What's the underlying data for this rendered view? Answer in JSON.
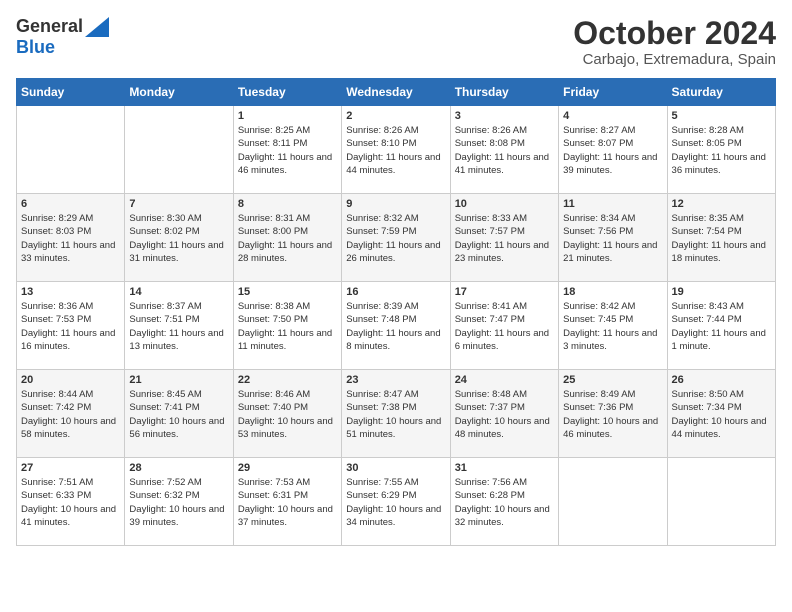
{
  "logo": {
    "general": "General",
    "blue": "Blue"
  },
  "header": {
    "month": "October 2024",
    "location": "Carbajo, Extremadura, Spain"
  },
  "weekdays": [
    "Sunday",
    "Monday",
    "Tuesday",
    "Wednesday",
    "Thursday",
    "Friday",
    "Saturday"
  ],
  "weeks": [
    [
      {
        "day": "",
        "sunrise": "",
        "sunset": "",
        "daylight": ""
      },
      {
        "day": "",
        "sunrise": "",
        "sunset": "",
        "daylight": ""
      },
      {
        "day": "1",
        "sunrise": "Sunrise: 8:25 AM",
        "sunset": "Sunset: 8:11 PM",
        "daylight": "Daylight: 11 hours and 46 minutes."
      },
      {
        "day": "2",
        "sunrise": "Sunrise: 8:26 AM",
        "sunset": "Sunset: 8:10 PM",
        "daylight": "Daylight: 11 hours and 44 minutes."
      },
      {
        "day": "3",
        "sunrise": "Sunrise: 8:26 AM",
        "sunset": "Sunset: 8:08 PM",
        "daylight": "Daylight: 11 hours and 41 minutes."
      },
      {
        "day": "4",
        "sunrise": "Sunrise: 8:27 AM",
        "sunset": "Sunset: 8:07 PM",
        "daylight": "Daylight: 11 hours and 39 minutes."
      },
      {
        "day": "5",
        "sunrise": "Sunrise: 8:28 AM",
        "sunset": "Sunset: 8:05 PM",
        "daylight": "Daylight: 11 hours and 36 minutes."
      }
    ],
    [
      {
        "day": "6",
        "sunrise": "Sunrise: 8:29 AM",
        "sunset": "Sunset: 8:03 PM",
        "daylight": "Daylight: 11 hours and 33 minutes."
      },
      {
        "day": "7",
        "sunrise": "Sunrise: 8:30 AM",
        "sunset": "Sunset: 8:02 PM",
        "daylight": "Daylight: 11 hours and 31 minutes."
      },
      {
        "day": "8",
        "sunrise": "Sunrise: 8:31 AM",
        "sunset": "Sunset: 8:00 PM",
        "daylight": "Daylight: 11 hours and 28 minutes."
      },
      {
        "day": "9",
        "sunrise": "Sunrise: 8:32 AM",
        "sunset": "Sunset: 7:59 PM",
        "daylight": "Daylight: 11 hours and 26 minutes."
      },
      {
        "day": "10",
        "sunrise": "Sunrise: 8:33 AM",
        "sunset": "Sunset: 7:57 PM",
        "daylight": "Daylight: 11 hours and 23 minutes."
      },
      {
        "day": "11",
        "sunrise": "Sunrise: 8:34 AM",
        "sunset": "Sunset: 7:56 PM",
        "daylight": "Daylight: 11 hours and 21 minutes."
      },
      {
        "day": "12",
        "sunrise": "Sunrise: 8:35 AM",
        "sunset": "Sunset: 7:54 PM",
        "daylight": "Daylight: 11 hours and 18 minutes."
      }
    ],
    [
      {
        "day": "13",
        "sunrise": "Sunrise: 8:36 AM",
        "sunset": "Sunset: 7:53 PM",
        "daylight": "Daylight: 11 hours and 16 minutes."
      },
      {
        "day": "14",
        "sunrise": "Sunrise: 8:37 AM",
        "sunset": "Sunset: 7:51 PM",
        "daylight": "Daylight: 11 hours and 13 minutes."
      },
      {
        "day": "15",
        "sunrise": "Sunrise: 8:38 AM",
        "sunset": "Sunset: 7:50 PM",
        "daylight": "Daylight: 11 hours and 11 minutes."
      },
      {
        "day": "16",
        "sunrise": "Sunrise: 8:39 AM",
        "sunset": "Sunset: 7:48 PM",
        "daylight": "Daylight: 11 hours and 8 minutes."
      },
      {
        "day": "17",
        "sunrise": "Sunrise: 8:41 AM",
        "sunset": "Sunset: 7:47 PM",
        "daylight": "Daylight: 11 hours and 6 minutes."
      },
      {
        "day": "18",
        "sunrise": "Sunrise: 8:42 AM",
        "sunset": "Sunset: 7:45 PM",
        "daylight": "Daylight: 11 hours and 3 minutes."
      },
      {
        "day": "19",
        "sunrise": "Sunrise: 8:43 AM",
        "sunset": "Sunset: 7:44 PM",
        "daylight": "Daylight: 11 hours and 1 minute."
      }
    ],
    [
      {
        "day": "20",
        "sunrise": "Sunrise: 8:44 AM",
        "sunset": "Sunset: 7:42 PM",
        "daylight": "Daylight: 10 hours and 58 minutes."
      },
      {
        "day": "21",
        "sunrise": "Sunrise: 8:45 AM",
        "sunset": "Sunset: 7:41 PM",
        "daylight": "Daylight: 10 hours and 56 minutes."
      },
      {
        "day": "22",
        "sunrise": "Sunrise: 8:46 AM",
        "sunset": "Sunset: 7:40 PM",
        "daylight": "Daylight: 10 hours and 53 minutes."
      },
      {
        "day": "23",
        "sunrise": "Sunrise: 8:47 AM",
        "sunset": "Sunset: 7:38 PM",
        "daylight": "Daylight: 10 hours and 51 minutes."
      },
      {
        "day": "24",
        "sunrise": "Sunrise: 8:48 AM",
        "sunset": "Sunset: 7:37 PM",
        "daylight": "Daylight: 10 hours and 48 minutes."
      },
      {
        "day": "25",
        "sunrise": "Sunrise: 8:49 AM",
        "sunset": "Sunset: 7:36 PM",
        "daylight": "Daylight: 10 hours and 46 minutes."
      },
      {
        "day": "26",
        "sunrise": "Sunrise: 8:50 AM",
        "sunset": "Sunset: 7:34 PM",
        "daylight": "Daylight: 10 hours and 44 minutes."
      }
    ],
    [
      {
        "day": "27",
        "sunrise": "Sunrise: 7:51 AM",
        "sunset": "Sunset: 6:33 PM",
        "daylight": "Daylight: 10 hours and 41 minutes."
      },
      {
        "day": "28",
        "sunrise": "Sunrise: 7:52 AM",
        "sunset": "Sunset: 6:32 PM",
        "daylight": "Daylight: 10 hours and 39 minutes."
      },
      {
        "day": "29",
        "sunrise": "Sunrise: 7:53 AM",
        "sunset": "Sunset: 6:31 PM",
        "daylight": "Daylight: 10 hours and 37 minutes."
      },
      {
        "day": "30",
        "sunrise": "Sunrise: 7:55 AM",
        "sunset": "Sunset: 6:29 PM",
        "daylight": "Daylight: 10 hours and 34 minutes."
      },
      {
        "day": "31",
        "sunrise": "Sunrise: 7:56 AM",
        "sunset": "Sunset: 6:28 PM",
        "daylight": "Daylight: 10 hours and 32 minutes."
      },
      {
        "day": "",
        "sunrise": "",
        "sunset": "",
        "daylight": ""
      },
      {
        "day": "",
        "sunrise": "",
        "sunset": "",
        "daylight": ""
      }
    ]
  ]
}
